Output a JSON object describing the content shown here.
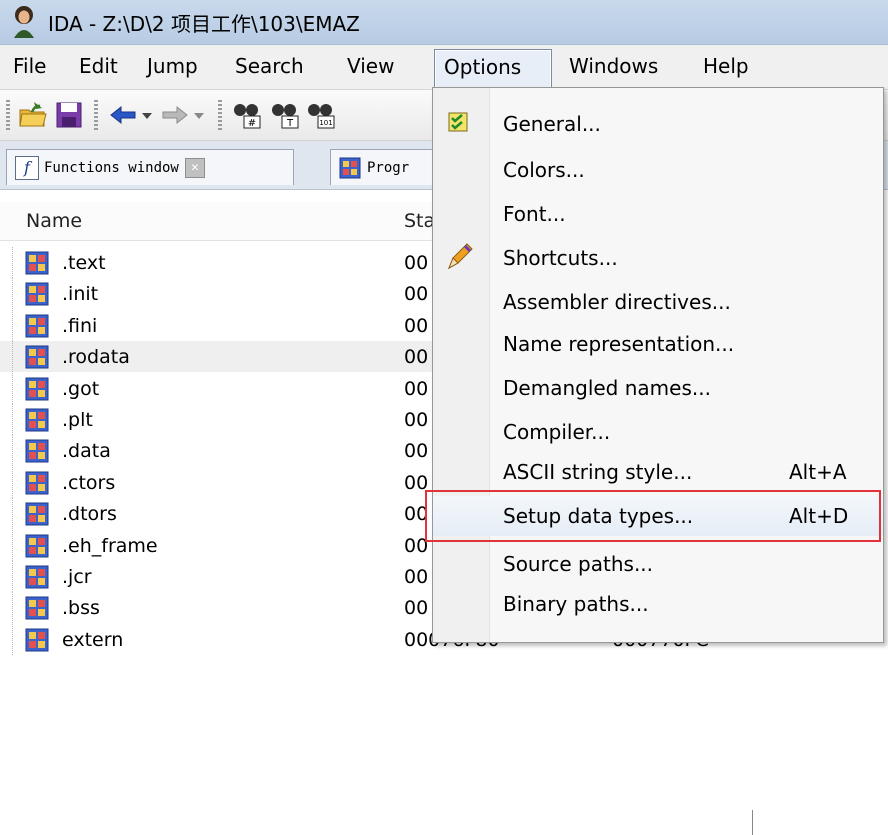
{
  "window": {
    "title": "IDA - Z:\\D\\2 项目工作\\103\\EMAZ"
  },
  "menubar": {
    "items": [
      {
        "label": "File"
      },
      {
        "label": "Edit"
      },
      {
        "label": "Jump"
      },
      {
        "label": "Search"
      },
      {
        "label": "View"
      },
      {
        "label": "Options"
      },
      {
        "label": "Windows"
      },
      {
        "label": "Help"
      }
    ]
  },
  "toolbar": {
    "icons": [
      "open-folder-icon",
      "save-icon",
      "back-arrow-icon",
      "dropdown-icon",
      "forward-arrow-icon",
      "dropdown-icon",
      "binoculars-hash-icon",
      "binoculars-text-icon",
      "binoculars-binary-icon"
    ]
  },
  "tabs": [
    {
      "label": "Functions window",
      "icon": "function-icon",
      "closable": true
    },
    {
      "label": "Progr",
      "icon": "program-segments-icon"
    }
  ],
  "list": {
    "columns": [
      "Name",
      "Sta"
    ],
    "rows": [
      {
        "name": ".text",
        "start": "00",
        "end": ""
      },
      {
        "name": ".init",
        "start": "00",
        "end": ""
      },
      {
        "name": ".fini",
        "start": "00",
        "end": ""
      },
      {
        "name": ".rodata",
        "start": "00",
        "end": "",
        "selected": true
      },
      {
        "name": ".got",
        "start": "00",
        "end": ""
      },
      {
        "name": ".plt",
        "start": "00",
        "end": ""
      },
      {
        "name": ".data",
        "start": "00",
        "end": ""
      },
      {
        "name": ".ctors",
        "start": "00",
        "end": ""
      },
      {
        "name": ".dtors",
        "start": "00",
        "end": ""
      },
      {
        "name": ".eh_frame",
        "start": "00",
        "end": ""
      },
      {
        "name": ".jcr",
        "start": "00",
        "end": ""
      },
      {
        "name": ".bss",
        "start": "00",
        "end": ""
      },
      {
        "name": "extern",
        "start": "00076F80",
        "end": "000770FC"
      }
    ]
  },
  "options_menu": {
    "items": [
      {
        "label": "General...",
        "shortcut": "",
        "icon": "checkbox-icon"
      },
      {
        "label": "Colors...",
        "shortcut": ""
      },
      {
        "label": "Font...",
        "shortcut": ""
      },
      {
        "label": "Shortcuts...",
        "shortcut": "",
        "icon": "pencil-icon"
      },
      {
        "label": "Assembler directives...",
        "shortcut": ""
      },
      {
        "label": "Name representation...",
        "shortcut": ""
      },
      {
        "label": "Demangled names...",
        "shortcut": ""
      },
      {
        "label": "Compiler...",
        "shortcut": ""
      },
      {
        "label": "ASCII string style...",
        "shortcut": "Alt+A"
      },
      {
        "label": "Setup data types...",
        "shortcut": "Alt+D",
        "highlighted": true
      },
      {
        "label": "Source paths...",
        "shortcut": ""
      },
      {
        "label": "Binary paths...",
        "shortcut": ""
      }
    ]
  },
  "colors": {
    "highlight_border": "#e2333c",
    "accent": "#1f3a8a"
  }
}
